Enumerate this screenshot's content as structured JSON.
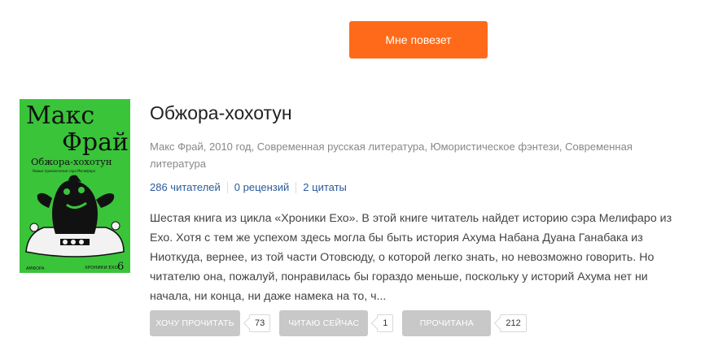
{
  "lucky_button": "Мне повезет",
  "book": {
    "cover": {
      "author_line1": "Макс",
      "author_line2": "Фрай",
      "title": "Обжора-хохотун",
      "series": "ХРОНИКИ ЕХО",
      "volume": "6",
      "subtitle": "Новые приключения сэра Мелифаро",
      "publisher": "АМФОРА",
      "bg_color": "#3ac43a"
    },
    "title": "Обжора-хохотун",
    "meta": "Макс Фрай, 2010 год, Современная русская литература, Юмористическое фэнтези, Современная литература",
    "stats": {
      "readers": "286 читателей",
      "reviews": "0 рецензий",
      "quotes": "2 цитаты"
    },
    "description": "Шестая книга из цикла «Хроники Ехо». В этой книге читатель найдет историю сэра Мелифаро из Ехо. Хотя с тем же успехом здесь могла бы быть история Ахума Набана Дуана Ганабака из Ниоткуда, вернее, из той части Отовсюду, о которой легко знать, но невозможно говорить. Но читателю она, пожалуй, понравилась бы гораздо меньше, поскольку у историй Ахума нет ни начала, ни конца, ни даже намека на то, ч...",
    "actions": [
      {
        "label": "ХОЧУ ПРОЧИТАТЬ",
        "count": "73"
      },
      {
        "label": "ЧИТАЮ СЕЙЧАС",
        "count": "1"
      },
      {
        "label": "ПРОЧИТАНА",
        "count": "212"
      }
    ]
  },
  "colors": {
    "accent": "#ff6a1a",
    "link": "#2a5a9c",
    "action_bg": "#c8c8c8"
  }
}
